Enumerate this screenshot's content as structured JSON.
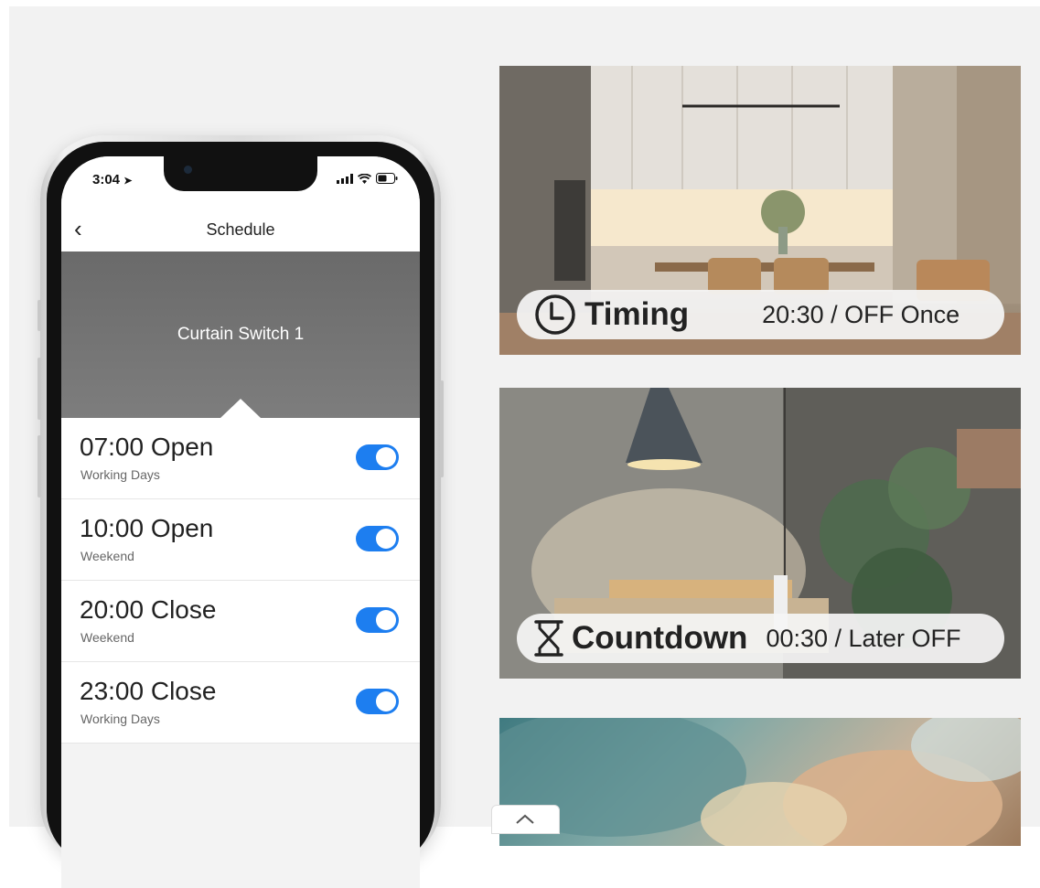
{
  "phone": {
    "status_time": "3:04",
    "header_title": "Schedule",
    "back_glyph": "‹",
    "device_name": "Curtain Switch 1",
    "schedules": [
      {
        "time": "07:00 Open",
        "repeat": "Working Days",
        "enabled": true
      },
      {
        "time": "10:00 Open",
        "repeat": "Weekend",
        "enabled": true
      },
      {
        "time": "20:00 Close",
        "repeat": "Weekend",
        "enabled": true
      },
      {
        "time": "23:00 Close",
        "repeat": "Working Days",
        "enabled": true
      }
    ],
    "toggle_color": "#1d7ef0"
  },
  "cards": [
    {
      "label": "Timing",
      "value": "20:30 / OFF Once",
      "icon": "clock-icon"
    },
    {
      "label": "Countdown",
      "value": "00:30 / Later OFF",
      "icon": "hourglass-icon"
    }
  ]
}
